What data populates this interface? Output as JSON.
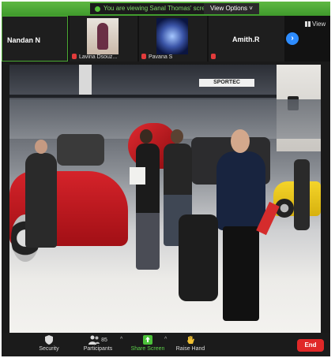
{
  "banner": {
    "text": "You are viewing Sanal Thomas' screen",
    "view_options": "View Options ˅"
  },
  "gallery": {
    "tiles": [
      {
        "name": "Nandan N",
        "caption": ""
      },
      {
        "name": "",
        "caption": "Lavina Dsouz..."
      },
      {
        "name": "",
        "caption": "Pavana S"
      },
      {
        "name": "Amith.R",
        "caption": ""
      }
    ],
    "next": "›",
    "view_label": "View"
  },
  "shared_screen": {
    "sign": "SPORTEC"
  },
  "toolbar": {
    "security": "Security",
    "participants": "Participants",
    "participants_count": "85",
    "caret": "^",
    "share": "Share Screen",
    "raise_hand": "Raise Hand",
    "end": "End"
  },
  "colors": {
    "zoom_green": "#4aa832",
    "zoom_blue": "#2d8cff",
    "end_red": "#e02828"
  }
}
